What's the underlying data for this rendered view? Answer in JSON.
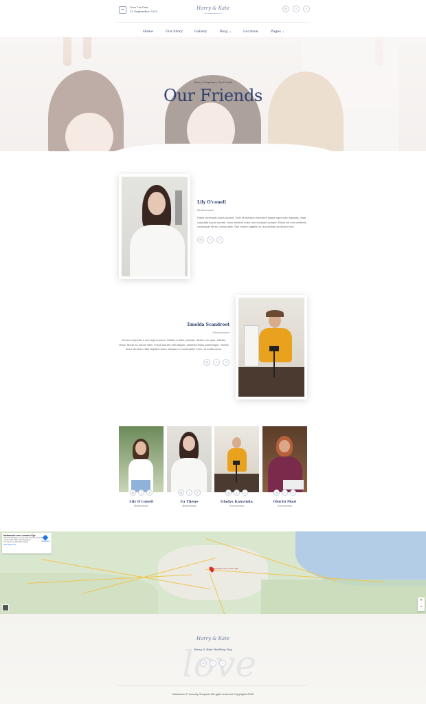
{
  "header": {
    "save_date_label": "Save The Date",
    "save_date_value": "15 September 2025",
    "logo": "Harry & Kate",
    "social": [
      "◎",
      "t",
      "f"
    ]
  },
  "nav": {
    "items": [
      "Home",
      "Our Story",
      "Gallery",
      "Blog ⌄",
      "Location",
      "Pages ⌄"
    ]
  },
  "hero": {
    "breadcrumb": "Home | Templates | Our Friends",
    "title": "Our Friends"
  },
  "features": [
    {
      "name": "Lily O'conell",
      "role": "Bridesmade",
      "desc": "Etiam venenatis luctus laoreet. Duis et interdum hendrerit neque eget enim egestas, vitae vulputate ipsum laoreet. Nam eleifend tortor non tincidunt semper. Etiam vel eros eleifend, consequat elit eu, luctus ante. Sed ornare sagittis mi, at pulvinar dui dictum sed."
    },
    {
      "name": "Emelda Scandroot",
      "role": "Groomsman",
      "desc": "Donec imperdiet a sem eget cursus. Nullam a diam pulvinar, dictum orci quis, efficitur tellus. Morbi eu rutrum nibh. Fusce laoreet velit aliquet, pharetra tellus scelerisque, viverra dolor. Aenean vitae dapibus dolor. Aliquam in consectetur enim, at mollis lacus."
    }
  ],
  "grid": [
    {
      "name": "Lily O'conell",
      "role": "Bridesmaid"
    },
    {
      "name": "Ea Tijene",
      "role": "Bridesmaid"
    },
    {
      "name": "Gladys Kanyinda",
      "role": "Groomsmen"
    },
    {
      "name": "Oluchi Mazi",
      "role": "Groomsmen"
    }
  ],
  "map": {
    "place_title": "lastminute.com London Eye",
    "place_addr": "Riverside Building, County Hall, Westminster Bridge Rd, London SE1 7PB, United Kingdom",
    "rating": "4.5 ★★★★★  215,630 reviews",
    "larger_map": "View larger map",
    "directions": "Directions",
    "zoom_in": "+",
    "zoom_out": "−",
    "pin_label": "lastminute.com London Eye"
  },
  "footer": {
    "logo": "Harry & Kate",
    "tagline": "Harry & Kate Wedding Day",
    "watermark": "love",
    "copyright": "Marbuloso © Loveaty Template All rights reserved Copyrights 2025"
  }
}
